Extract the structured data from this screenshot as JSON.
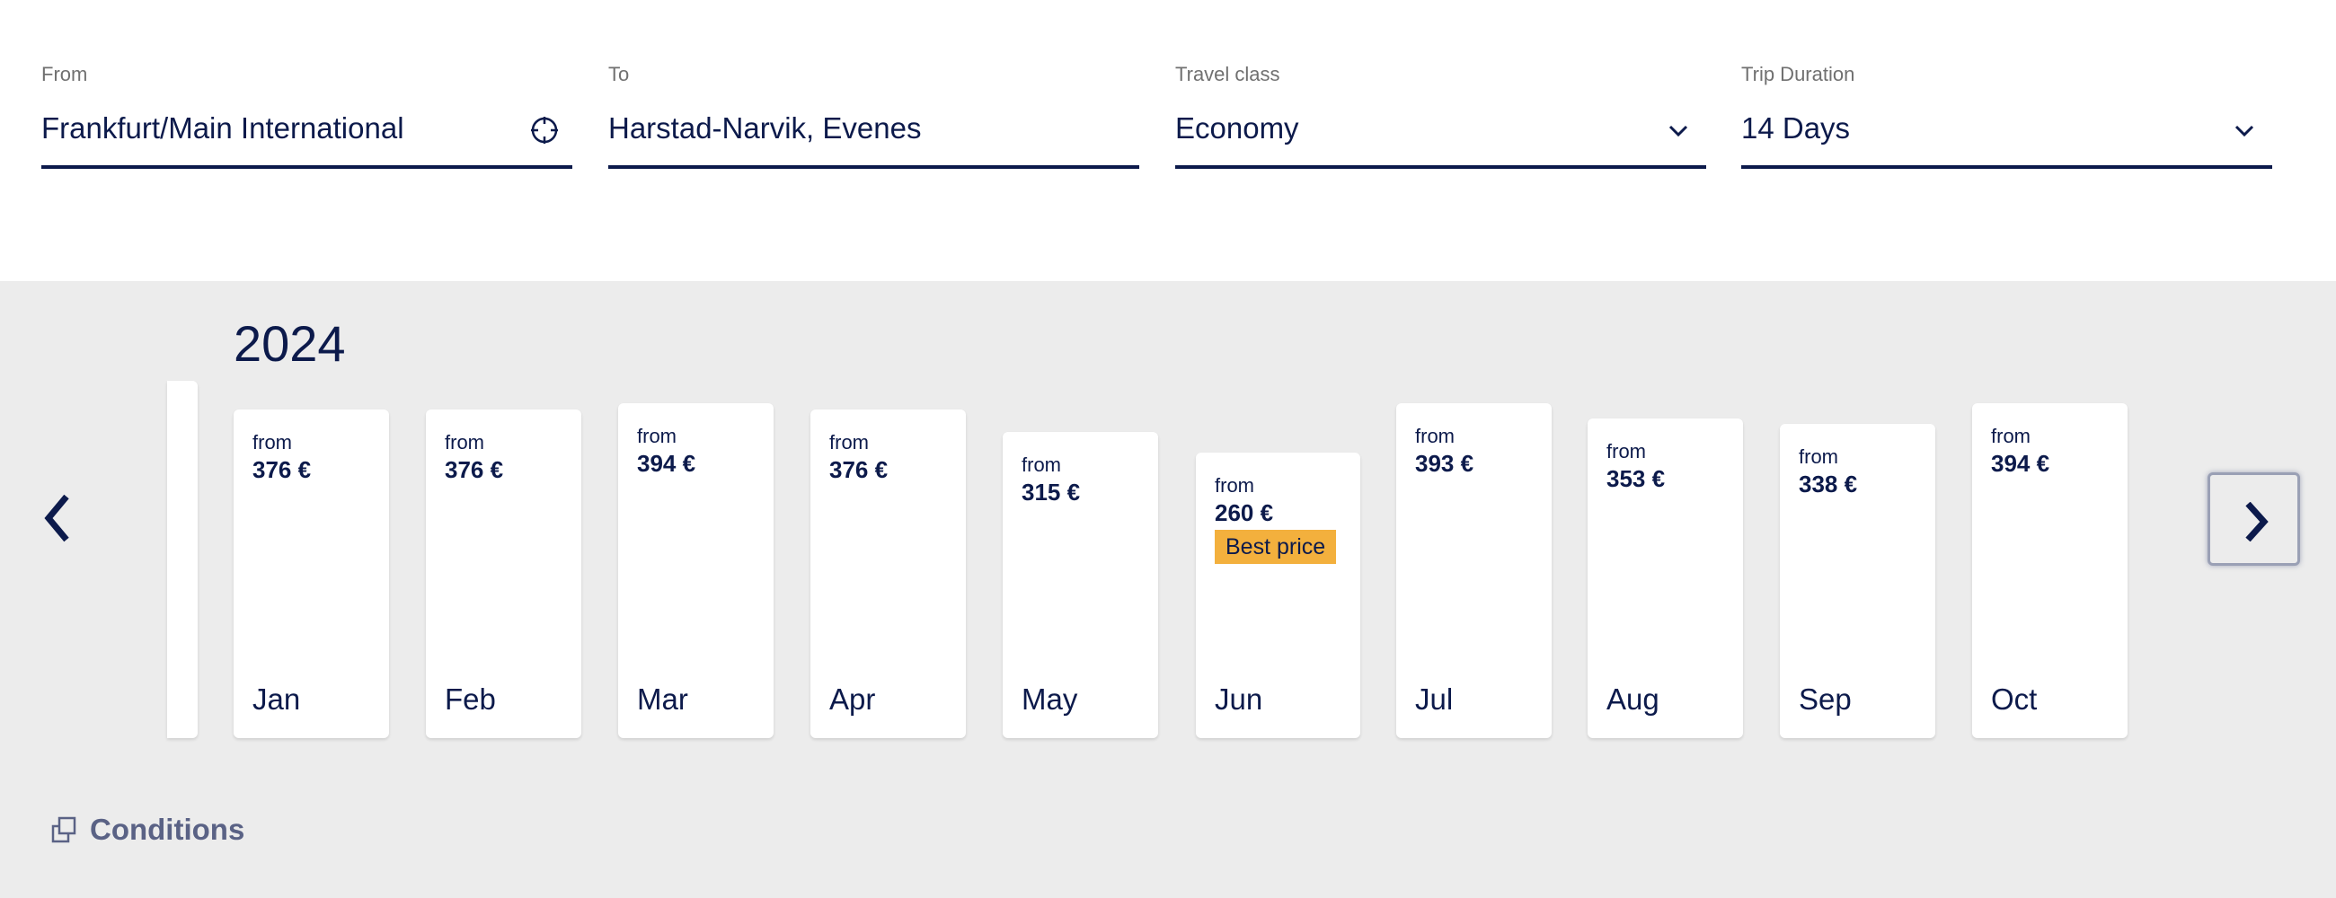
{
  "search": {
    "from": {
      "label": "From",
      "value": "Frankfurt/Main International",
      "icon": "crosshair-icon"
    },
    "to": {
      "label": "To",
      "value": "Harstad-Narvik, Evenes"
    },
    "travel_class": {
      "label": "Travel class",
      "value": "Economy",
      "icon": "chevron-down-icon"
    },
    "trip_duration": {
      "label": "Trip Duration",
      "value": "14 Days",
      "icon": "chevron-down-icon"
    }
  },
  "calendar": {
    "year": "2024",
    "months": [
      {
        "prefix": "from",
        "price": "376 €",
        "price_value": 376,
        "month": "Jan"
      },
      {
        "prefix": "from",
        "price": "376 €",
        "price_value": 376,
        "month": "Feb"
      },
      {
        "prefix": "from",
        "price": "394 €",
        "price_value": 394,
        "month": "Mar"
      },
      {
        "prefix": "from",
        "price": "376 €",
        "price_value": 376,
        "month": "Apr"
      },
      {
        "prefix": "from",
        "price": "315 €",
        "price_value": 315,
        "month": "May"
      },
      {
        "prefix": "from",
        "price": "260 €",
        "price_value": 260,
        "month": "Jun",
        "badge": "Best price"
      },
      {
        "prefix": "from",
        "price": "393 €",
        "price_value": 393,
        "month": "Jul"
      },
      {
        "prefix": "from",
        "price": "353 €",
        "price_value": 353,
        "month": "Aug"
      },
      {
        "prefix": "from",
        "price": "338 €",
        "price_value": 338,
        "month": "Sep"
      },
      {
        "prefix": "from",
        "price": "394 €",
        "price_value": 394,
        "month": "Oct"
      }
    ]
  },
  "conditions": {
    "label": "Conditions",
    "icon": "copy-icon"
  },
  "colors": {
    "navy": "#0c1a4b",
    "badge": "#f3b03d",
    "background": "#ececec"
  }
}
